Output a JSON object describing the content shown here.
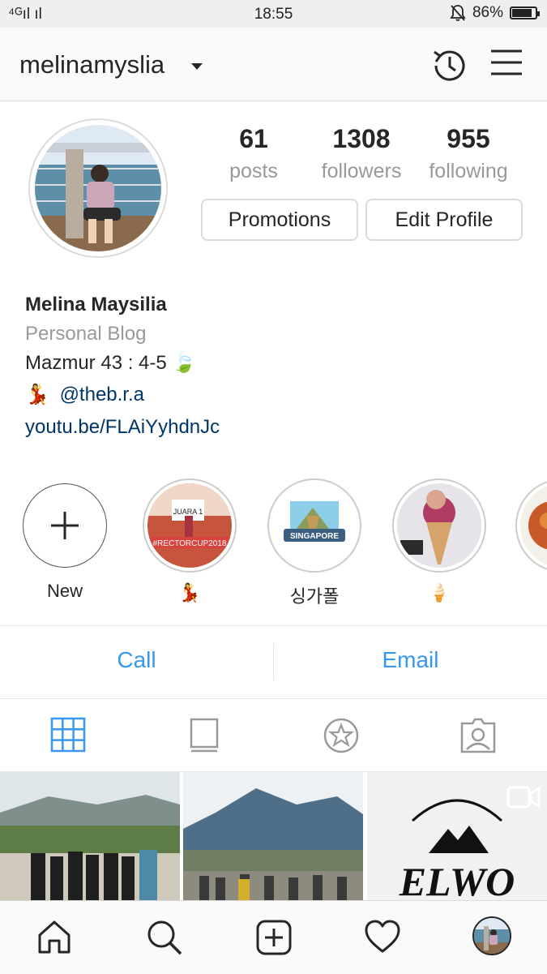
{
  "status_bar": {
    "signal": "⁴ᴳıl ıl",
    "time": "18:55",
    "battery": "86%",
    "battery_level": 0.86
  },
  "header": {
    "username": "melinamyslia"
  },
  "stats": [
    {
      "value": "61",
      "label": "posts"
    },
    {
      "value": "1308",
      "label": "followers"
    },
    {
      "value": "955",
      "label": "following"
    }
  ],
  "buttons": {
    "promotions": "Promotions",
    "edit_profile": "Edit Profile"
  },
  "bio": {
    "name": "Melina Maysilia",
    "category": "Personal Blog",
    "line1": "Mazmur 43 : 4-5 🍃",
    "mention_emoji": "💃",
    "mention": "@theb.r.a",
    "link": "youtu.be/FLAiYyhdnJc"
  },
  "highlights": [
    {
      "label": "New"
    },
    {
      "label": "💃",
      "cover_text": "#RECTORCUP2018",
      "sign": "JUARA 1"
    },
    {
      "label": "싱가폴",
      "cover_text": "SINGAPORE"
    },
    {
      "label": "🍦"
    }
  ],
  "contact": {
    "call": "Call",
    "email": "Email"
  },
  "grid": {
    "third_logo": "ELWO"
  },
  "colors": {
    "accent": "#3897f0",
    "link": "#003569",
    "muted": "#999999"
  }
}
